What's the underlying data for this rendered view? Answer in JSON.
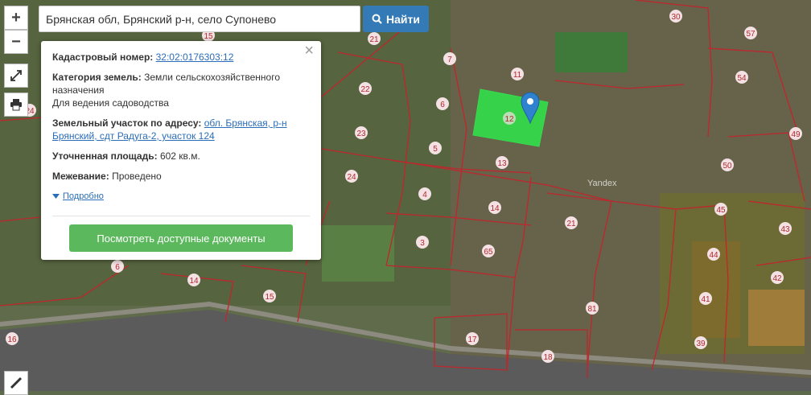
{
  "search": {
    "value": "Брянская обл, Брянский р-н, село Супонево",
    "button_label": "Найти"
  },
  "controls": {
    "zoom_in": "+",
    "zoom_out": "−"
  },
  "map": {
    "watermark": "Yandex",
    "highlight_color": "#2ee64a",
    "marker_color": "#2f82cf",
    "parcel_labels": [
      "30",
      "57",
      "15",
      "21",
      "7",
      "11",
      "22",
      "54",
      "6",
      "12",
      "24",
      "23",
      "49",
      "5",
      "13",
      "50",
      "24",
      "4",
      "14",
      "45",
      "21",
      "43",
      "3",
      "65",
      "44",
      "42",
      "6",
      "14",
      "15",
      "41",
      "81",
      "16",
      "17",
      "18",
      "39"
    ]
  },
  "popup": {
    "cadastral_label": "Кадастровый номер:",
    "cadastral_value": "32:02:0176303:12",
    "category_label": "Категория земель:",
    "category_value": "Земли сельскохозяйственного назначения",
    "category_use": "Для ведения садоводства",
    "address_label": "Земельный участок по адресу:",
    "address_value": "обл. Брянская, р-н Брянский, сдт Радуга-2, участок 124",
    "area_label": "Уточненная площадь:",
    "area_value": "602 кв.м.",
    "survey_label": "Межевание:",
    "survey_value": "Проведено",
    "more_link": "Подробно",
    "docs_button": "Посмотреть доступные документы"
  }
}
